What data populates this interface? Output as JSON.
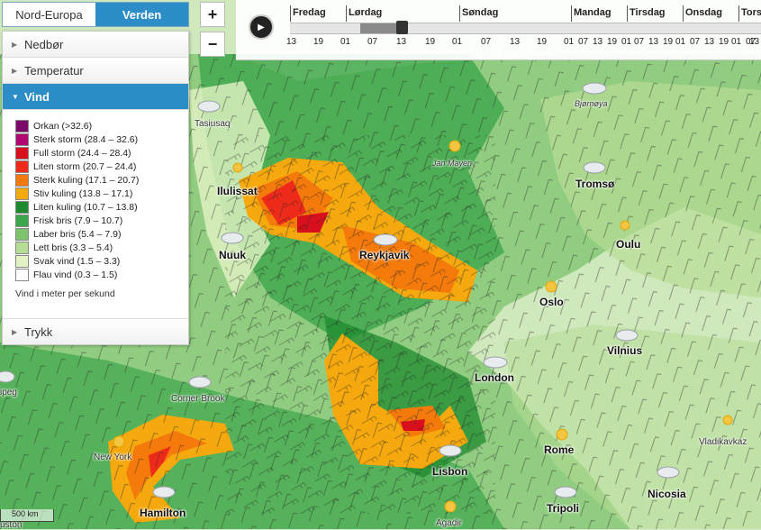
{
  "region_tabs": [
    {
      "label": "Nord-Europa",
      "active": false
    },
    {
      "label": "Verden",
      "active": true
    }
  ],
  "layers": {
    "precipitation": "Nedbør",
    "temperature": "Temperatur",
    "wind": "Vind",
    "pressure": "Trykk"
  },
  "legend": {
    "items": [
      {
        "label": "Orkan (>32.6)",
        "color": "#7a0a6a"
      },
      {
        "label": "Sterk storm (28.4 – 32.6)",
        "color": "#b0086e"
      },
      {
        "label": "Full storm (24.4 – 28.4)",
        "color": "#d8101e"
      },
      {
        "label": "Liten storm (20.7 – 24.4)",
        "color": "#ee2a1a"
      },
      {
        "label": "Sterk kuling (17.1 – 20.7)",
        "color": "#f47a0c"
      },
      {
        "label": "Stiv kuling (13.8 – 17.1)",
        "color": "#f5a90e"
      },
      {
        "label": "Liten kuling (10.7 – 13.8)",
        "color": "#1e8a2e"
      },
      {
        "label": "Frisk bris (7.9 – 10.7)",
        "color": "#3da64a"
      },
      {
        "label": "Laber bris (5.4 – 7.9)",
        "color": "#7cc46e"
      },
      {
        "label": "Lett bris (3.3 – 5.4)",
        "color": "#b6dd94"
      },
      {
        "label": "Svak vind (1.5 – 3.3)",
        "color": "#e4f2c4"
      },
      {
        "label": "Flau vind (0.3 – 1.5)",
        "color": "#ffffff"
      }
    ],
    "note": "Vind i meter per sekund"
  },
  "zoom": {
    "in": "+",
    "out": "−"
  },
  "timeline": {
    "play_icon": "play-icon",
    "days": [
      {
        "label": "Fredag"
      },
      {
        "label": "Lørdag"
      },
      {
        "label": "Søndag"
      },
      {
        "label": "Mandag"
      },
      {
        "label": "Tirsdag"
      },
      {
        "label": "Onsdag"
      },
      {
        "label": "Torsd"
      }
    ],
    "hours": [
      "13",
      "19",
      "01",
      "07",
      "13",
      "19",
      "01",
      "07",
      "13",
      "19",
      "01",
      "07",
      "13",
      "19",
      "01",
      "07",
      "13",
      "19",
      "01",
      "07",
      "13",
      "19",
      "01",
      "07",
      "13"
    ]
  },
  "places": {
    "tasiusaq": "Tasiusaq",
    "ilulissat": "Ilulissat",
    "nuuk": "Nuuk",
    "jan_mayen": "Jan Mayen",
    "bjornoya": "Bjørnøya",
    "tromso": "Tromsø",
    "oulu": "Oulu",
    "reykjavik": "Reykjavik",
    "oslo": "Oslo",
    "vilnius": "Vilnius",
    "london": "London",
    "corner_brook": "Corner Brook",
    "winnipeg": "ipeg",
    "new_york": "New York",
    "hamilton": "Hamilton",
    "lisbon": "Lisbon",
    "rome": "Rome",
    "vladikavkaz": "Vladikavkaz",
    "nicosia": "Nicosia",
    "tripoli": "Tripoli",
    "agadir": "Agadir",
    "houston": "uston"
  },
  "scalebar": "500 km"
}
